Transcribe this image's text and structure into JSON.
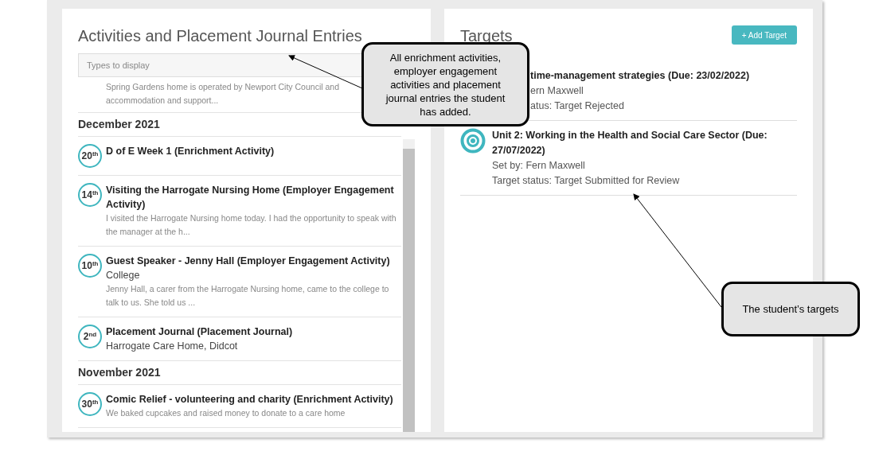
{
  "activities_panel": {
    "title": "Activities and Placement Journal Entries",
    "filter": {
      "placeholder": "Types to display"
    },
    "entries": [
      {
        "kind": "snippet",
        "lines": [
          "Spring Gardens home is operated by Newport City Council and",
          "accommodation and support..."
        ]
      },
      {
        "kind": "month",
        "label": "December 2021"
      },
      {
        "kind": "entry",
        "day": "20",
        "suffix": "th",
        "title": "D of E Week 1 (Enrichment Activity)"
      },
      {
        "kind": "entry",
        "day": "14",
        "suffix": "th",
        "title": "Visiting the Harrogate Nursing Home (Employer Engagement Activity)",
        "excerpt": "I visited the Harrogate Nursing home today. I had the opportunity to speak with the manager at the h..."
      },
      {
        "kind": "entry",
        "day": "10",
        "suffix": "th",
        "title": "Guest Speaker - Jenny Hall (Employer Engagement Activity)",
        "location": "College",
        "excerpt": "Jenny Hall, a carer from the Harrogate Nursing home, came to the college to talk to us. She told us ..."
      },
      {
        "kind": "entry",
        "day": "2",
        "suffix": "nd",
        "title": "Placement Journal (Placement Journal)",
        "location": "Harrogate Care Home, Didcot"
      },
      {
        "kind": "month",
        "label": "November 2021"
      },
      {
        "kind": "entry",
        "day": "30",
        "suffix": "th",
        "title": "Comic Relief - volunteering and charity (Enrichment Activity)",
        "excerpt": "We baked cupcakes and raised money to donate to a care home"
      }
    ]
  },
  "targets_panel": {
    "title": "Targets",
    "add_button": "+ Add Target",
    "targets": [
      {
        "kind": "covered",
        "title": "time-management strategies (Due: 23/02/2022)",
        "set_by": "ern Maxwell",
        "status": "atus: Target Rejected"
      },
      {
        "kind": "full",
        "title": "Unit 2: Working in the Health and Social Care Sector (Due: 27/07/2022)",
        "set_by": "Set by: Fern Maxwell",
        "status": "Target status: Target Submitted for Review"
      }
    ]
  },
  "callouts": [
    {
      "text": "All enrichment activities, employer engagement activities and placement journal entries the student has added."
    },
    {
      "text": "The student’s targets"
    }
  ]
}
